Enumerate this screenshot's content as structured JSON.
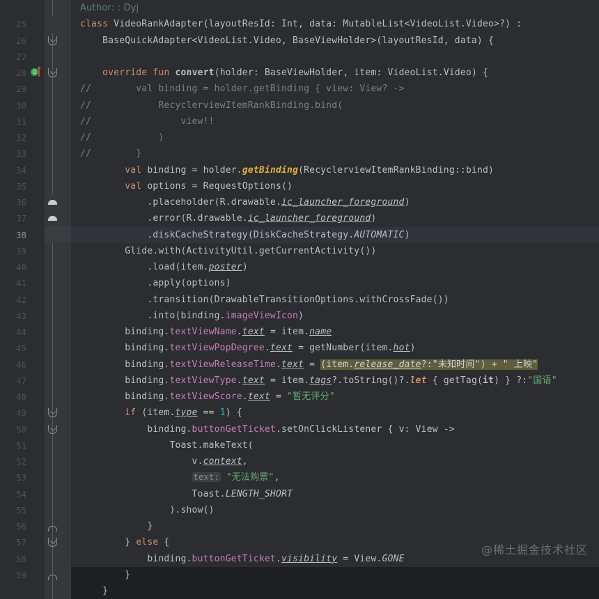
{
  "editor": {
    "background": "#2b2d30",
    "gutter_background": "#2b2d30",
    "fold_background": "#35373b",
    "current_line_background": "#31333a",
    "selection_color": "#5f5e3c",
    "keyword_color": "#cf8e6d",
    "string_color": "#6aab73",
    "comment_color": "#7a7e85",
    "property_color": "#c77dbb",
    "number_color": "#2aacb8",
    "function_color": "#56a8f5",
    "default_text_color": "#bcbec4",
    "line_number_color": "#4e5157"
  },
  "watermark": "@稀土掘金技术社区",
  "gutter_icons": {
    "override_icon_label": "O",
    "override_icon_title": "overriding-method-icon",
    "fold_expanded_title": "fold-region-expanded",
    "fold_collapsed_title": "fold-region-collapsed"
  },
  "lines": [
    {
      "no": "",
      "text": "Author: : Dyj"
    },
    {
      "no": "25",
      "text": "class VideoRankAdapter(layoutResId: Int, data: MutableList<VideoList.Video>?) :"
    },
    {
      "no": "26",
      "text": "    BaseQuickAdapter<VideoList.Video, BaseViewHolder>(layoutResId, data) {"
    },
    {
      "no": "27",
      "text": ""
    },
    {
      "no": "28",
      "text": "    override fun convert(holder: BaseViewHolder, item: VideoList.Video) {"
    },
    {
      "no": "29",
      "text": "//        val binding = holder.getBinding { view: View? ->"
    },
    {
      "no": "30",
      "text": "//            RecyclerviewItemRankBinding.bind("
    },
    {
      "no": "31",
      "text": "//                view!!"
    },
    {
      "no": "32",
      "text": "//            )"
    },
    {
      "no": "33",
      "text": "//        }"
    },
    {
      "no": "34",
      "text": "        val binding = holder.getBinding(RecyclerviewItemRankBinding::bind)"
    },
    {
      "no": "35",
      "text": "        val options = RequestOptions()"
    },
    {
      "no": "36",
      "text": "            .placeholder(R.drawable.ic_launcher_foreground)"
    },
    {
      "no": "37",
      "text": "            .error(R.drawable.ic_launcher_foreground)"
    },
    {
      "no": "38",
      "text": "            .diskCacheStrategy(DiskCacheStrategy.AUTOMATIC)"
    },
    {
      "no": "39",
      "text": "        Glide.with(ActivityUtil.getCurrentActivity())"
    },
    {
      "no": "40",
      "text": "            .load(item.poster)"
    },
    {
      "no": "41",
      "text": "            .apply(options)"
    },
    {
      "no": "42",
      "text": "            .transition(DrawableTransitionOptions.withCrossFade())"
    },
    {
      "no": "43",
      "text": "            .into(binding.imageViewIcon)"
    },
    {
      "no": "44",
      "text": "        binding.textViewName.text = item.name"
    },
    {
      "no": "45",
      "text": "        binding.textViewPopDegree.text = getNumber(item.hot)"
    },
    {
      "no": "46",
      "text": "        binding.textViewReleaseTime.text = (item.release_date?:\"未知时间\") + \" 上映\""
    },
    {
      "no": "47",
      "text": "        binding.textViewType.text = item.tags?.toString()?.let { getTag(it) } ?:\"国语\""
    },
    {
      "no": "48",
      "text": "        binding.textViewScore.text = \"暂无评分\""
    },
    {
      "no": "49",
      "text": "        if (item.type == 1) {"
    },
    {
      "no": "50",
      "text": "            binding.buttonGetTicket.setOnClickListener { v: View ->"
    },
    {
      "no": "51",
      "text": "                Toast.makeText("
    },
    {
      "no": "52",
      "text": "                    v.context,"
    },
    {
      "no": "53",
      "text": "                    text: \"无法购票\","
    },
    {
      "no": "54",
      "text": "                    Toast.LENGTH_SHORT"
    },
    {
      "no": "55",
      "text": "                ).show()"
    },
    {
      "no": "56",
      "text": "            }"
    },
    {
      "no": "57",
      "text": "        } else {"
    },
    {
      "no": "58",
      "text": "            binding.buttonGetTicket.visibility = View.GONE"
    },
    {
      "no": "59",
      "text": "        }"
    },
    {
      "no": "",
      "text": ""
    }
  ],
  "tokens": {
    "doc_author": "Author: : Dyj",
    "kw_class": "class",
    "kw_override": "override",
    "kw_fun": "fun",
    "kw_val": "val",
    "kw_if": "if",
    "kw_else": "else",
    "kw_let": "let",
    "str_unknown_time": "\"未知时间\"",
    "str_release": "\" 上映\"",
    "str_mandarin": "\"国语\"",
    "str_no_score": "\"暂无评分\"",
    "str_cannot_buy": "\"无法购票\"",
    "hint_text_param": "text:",
    "num_one": "1"
  }
}
